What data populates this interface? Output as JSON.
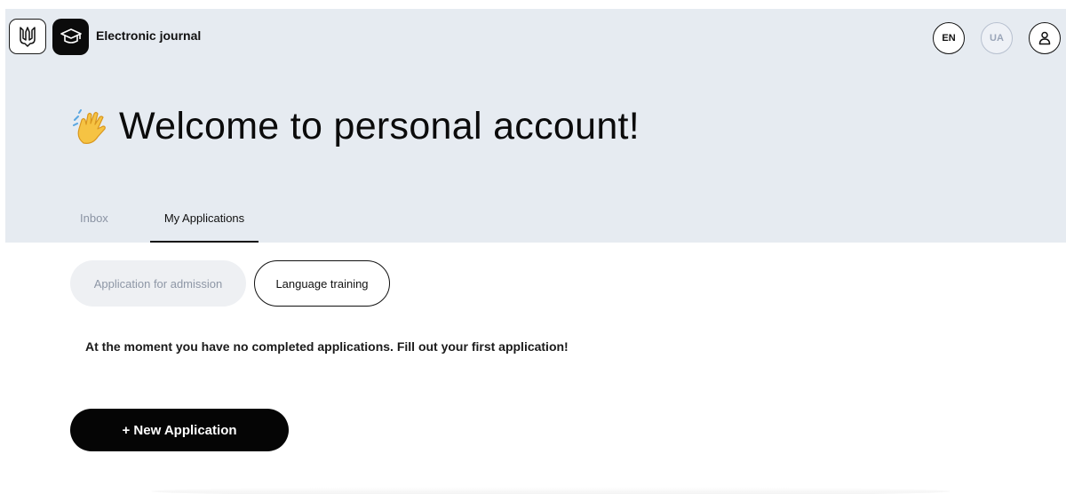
{
  "header": {
    "emblem_icon": "trident-icon",
    "logo_icon": "graduation-cap-icon",
    "app_title": "Electronic journal",
    "lang_en": "EN",
    "lang_ua": "UA",
    "profile_icon": "user-icon",
    "background_color": "#e6ebf1"
  },
  "welcome": {
    "emoji_icon": "waving-hand-icon",
    "title": "Welcome to personal account!"
  },
  "tabs": [
    {
      "label": "Inbox",
      "active": false
    },
    {
      "label": "My Applications",
      "active": true
    }
  ],
  "filters": [
    {
      "label": "Application for admission",
      "active": false
    },
    {
      "label": "Language training",
      "active": true
    }
  ],
  "main": {
    "empty_message": "At the moment you have no completed applications. Fill out your first application!",
    "new_application_label": "+ New Application"
  }
}
